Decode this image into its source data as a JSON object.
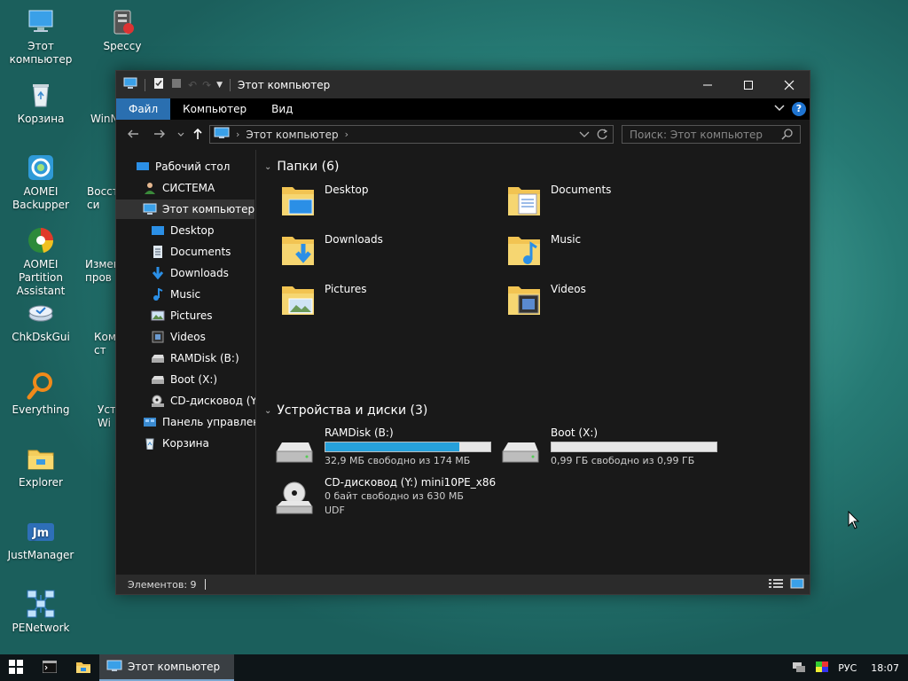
{
  "desktop": {
    "icons": [
      {
        "label": "Этот компьютер",
        "icon": "this-pc-icon"
      },
      {
        "label": "Speccy",
        "icon": "speccy-icon"
      },
      {
        "label": "Корзина",
        "icon": "recycle-bin-icon"
      },
      {
        "label": "WinN",
        "icon": "winntsetup-icon"
      },
      {
        "label": "AOMEI Backupper",
        "icon": "aomei-backupper-icon"
      },
      {
        "label": "Восст си",
        "icon": "restore-icon"
      },
      {
        "label": "AOMEI Partition Assistant",
        "icon": "aomei-partition-icon"
      },
      {
        "label": "Измен пров",
        "icon": "edit-icon"
      },
      {
        "label": "ChkDskGui",
        "icon": "chkdsk-icon"
      },
      {
        "label": "Ком ст",
        "icon": "cmd-icon"
      },
      {
        "label": "Everything",
        "icon": "everything-search-icon"
      },
      {
        "label": "Уст Wi",
        "icon": "setup-icon"
      },
      {
        "label": "Explorer",
        "icon": "explorer-folder-icon"
      },
      {
        "label": "JustManager",
        "icon": "justmanager-icon"
      },
      {
        "label": "PENetwork",
        "icon": "network-icon"
      }
    ]
  },
  "window": {
    "title": "Этот компьютер",
    "ribbon_tabs": [
      "Файл",
      "Компьютер",
      "Вид"
    ],
    "active_tab": "Файл",
    "address": {
      "root": "Этот компьютер"
    },
    "search_placeholder": "Поиск: Этот компьютер",
    "help_label": "?"
  },
  "sidebar": {
    "items": [
      {
        "label": "Рабочий стол",
        "icon": "desktop-icon"
      },
      {
        "label": "СИСТЕМА",
        "icon": "user-icon"
      },
      {
        "label": "Этот компьютер",
        "icon": "this-pc-icon",
        "selected": true
      },
      {
        "label": "Desktop",
        "icon": "desktop-icon"
      },
      {
        "label": "Documents",
        "icon": "documents-icon"
      },
      {
        "label": "Downloads",
        "icon": "downloads-icon"
      },
      {
        "label": "Music",
        "icon": "music-icon"
      },
      {
        "label": "Pictures",
        "icon": "pictures-icon"
      },
      {
        "label": "Videos",
        "icon": "videos-icon"
      },
      {
        "label": "RAMDisk (B:)",
        "icon": "drive-icon"
      },
      {
        "label": "Boot (X:)",
        "icon": "drive-icon"
      },
      {
        "label": "CD-дисковод (Y:)",
        "icon": "cd-drive-icon"
      },
      {
        "label": "Панель управлени",
        "icon": "control-panel-icon"
      },
      {
        "label": "Корзина",
        "icon": "recycle-bin-icon"
      }
    ]
  },
  "content": {
    "folders_header": "Папки (6)",
    "folders": [
      {
        "name": "Desktop",
        "icon": "desktop-folder-icon"
      },
      {
        "name": "Documents",
        "icon": "documents-folder-icon"
      },
      {
        "name": "Downloads",
        "icon": "downloads-folder-icon"
      },
      {
        "name": "Music",
        "icon": "music-folder-icon"
      },
      {
        "name": "Pictures",
        "icon": "pictures-folder-icon"
      },
      {
        "name": "Videos",
        "icon": "videos-folder-icon"
      }
    ],
    "drives_header": "Устройства и диски (3)",
    "drives": [
      {
        "name": "RAMDisk (B:)",
        "free_text": "32,9 МБ свободно из 174 МБ",
        "used_fraction": 0.81,
        "icon": "hdd-icon"
      },
      {
        "name": "Boot (X:)",
        "free_text": "0,99 ГБ свободно из 0,99 ГБ",
        "used_fraction": 0.0,
        "icon": "hdd-icon"
      },
      {
        "name": "CD-дисковод (Y:) mini10PE_x86",
        "free_text": "0 байт свободно из 630 МБ",
        "fs": "UDF",
        "icon": "cd-drive-icon"
      }
    ]
  },
  "statusbar": {
    "items_text": "Элементов: 9"
  },
  "taskbar": {
    "task_label": "Этот компьютер",
    "language": "РУС",
    "time": "18:07"
  },
  "colors": {
    "accent": "#2a6fb0",
    "bar_fill": "#26a0da",
    "window_bg": "#191919"
  }
}
